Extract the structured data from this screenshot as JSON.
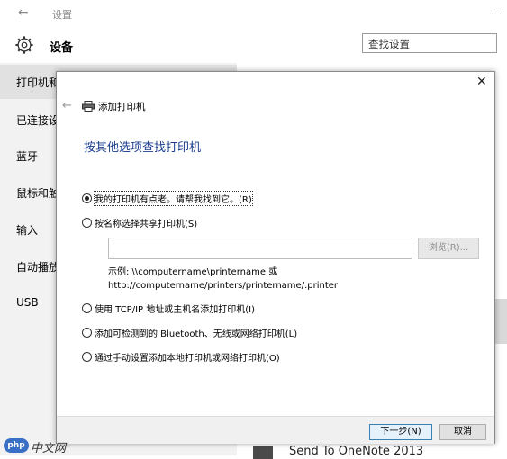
{
  "window": {
    "title": "设置"
  },
  "header": {
    "page_title": "设备",
    "search_placeholder": "查找设置"
  },
  "sidebar": {
    "items": [
      {
        "label": "打印机和",
        "active": true
      },
      {
        "label": "已连接设"
      },
      {
        "label": "蓝牙"
      },
      {
        "label": "鼠标和触"
      },
      {
        "label": "输入"
      },
      {
        "label": "自动播放"
      },
      {
        "label": "USB"
      }
    ]
  },
  "main": {
    "onenote_label": "Send To OneNote 2013"
  },
  "dialog": {
    "title": "添加打印机",
    "heading": "按其他选项查找打印机",
    "options": [
      {
        "label": "我的打印机有点老。请帮我找到它。(R)",
        "checked": true
      },
      {
        "label": "按名称选择共享打印机(S)",
        "checked": false
      },
      {
        "label": "使用 TCP/IP 地址或主机名添加打印机(I)",
        "checked": false
      },
      {
        "label": "添加可检测到的 Bluetooth、无线或网络打印机(L)",
        "checked": false
      },
      {
        "label": "通过手动设置添加本地打印机或网络打印机(O)",
        "checked": false
      }
    ],
    "share_input_value": "",
    "browse_label": "浏览(R)...",
    "example_line1": "示例: \\\\computername\\printername 或",
    "example_line2": "http://computername/printers/printername/.printer",
    "next_label": "下一步(N)",
    "cancel_label": "取消"
  },
  "watermark": {
    "logo_text": "php",
    "text": "中文网"
  },
  "colors": {
    "heading": "#1a3d8f",
    "sidebar_bg": "#f2f2f2",
    "sidebar_active": "#e1e1e1",
    "primary_button_border": "#3c7fb1"
  },
  "icons": [
    "back-arrow-icon",
    "minimize-icon",
    "gear-icon",
    "close-icon",
    "printer-icon"
  ]
}
